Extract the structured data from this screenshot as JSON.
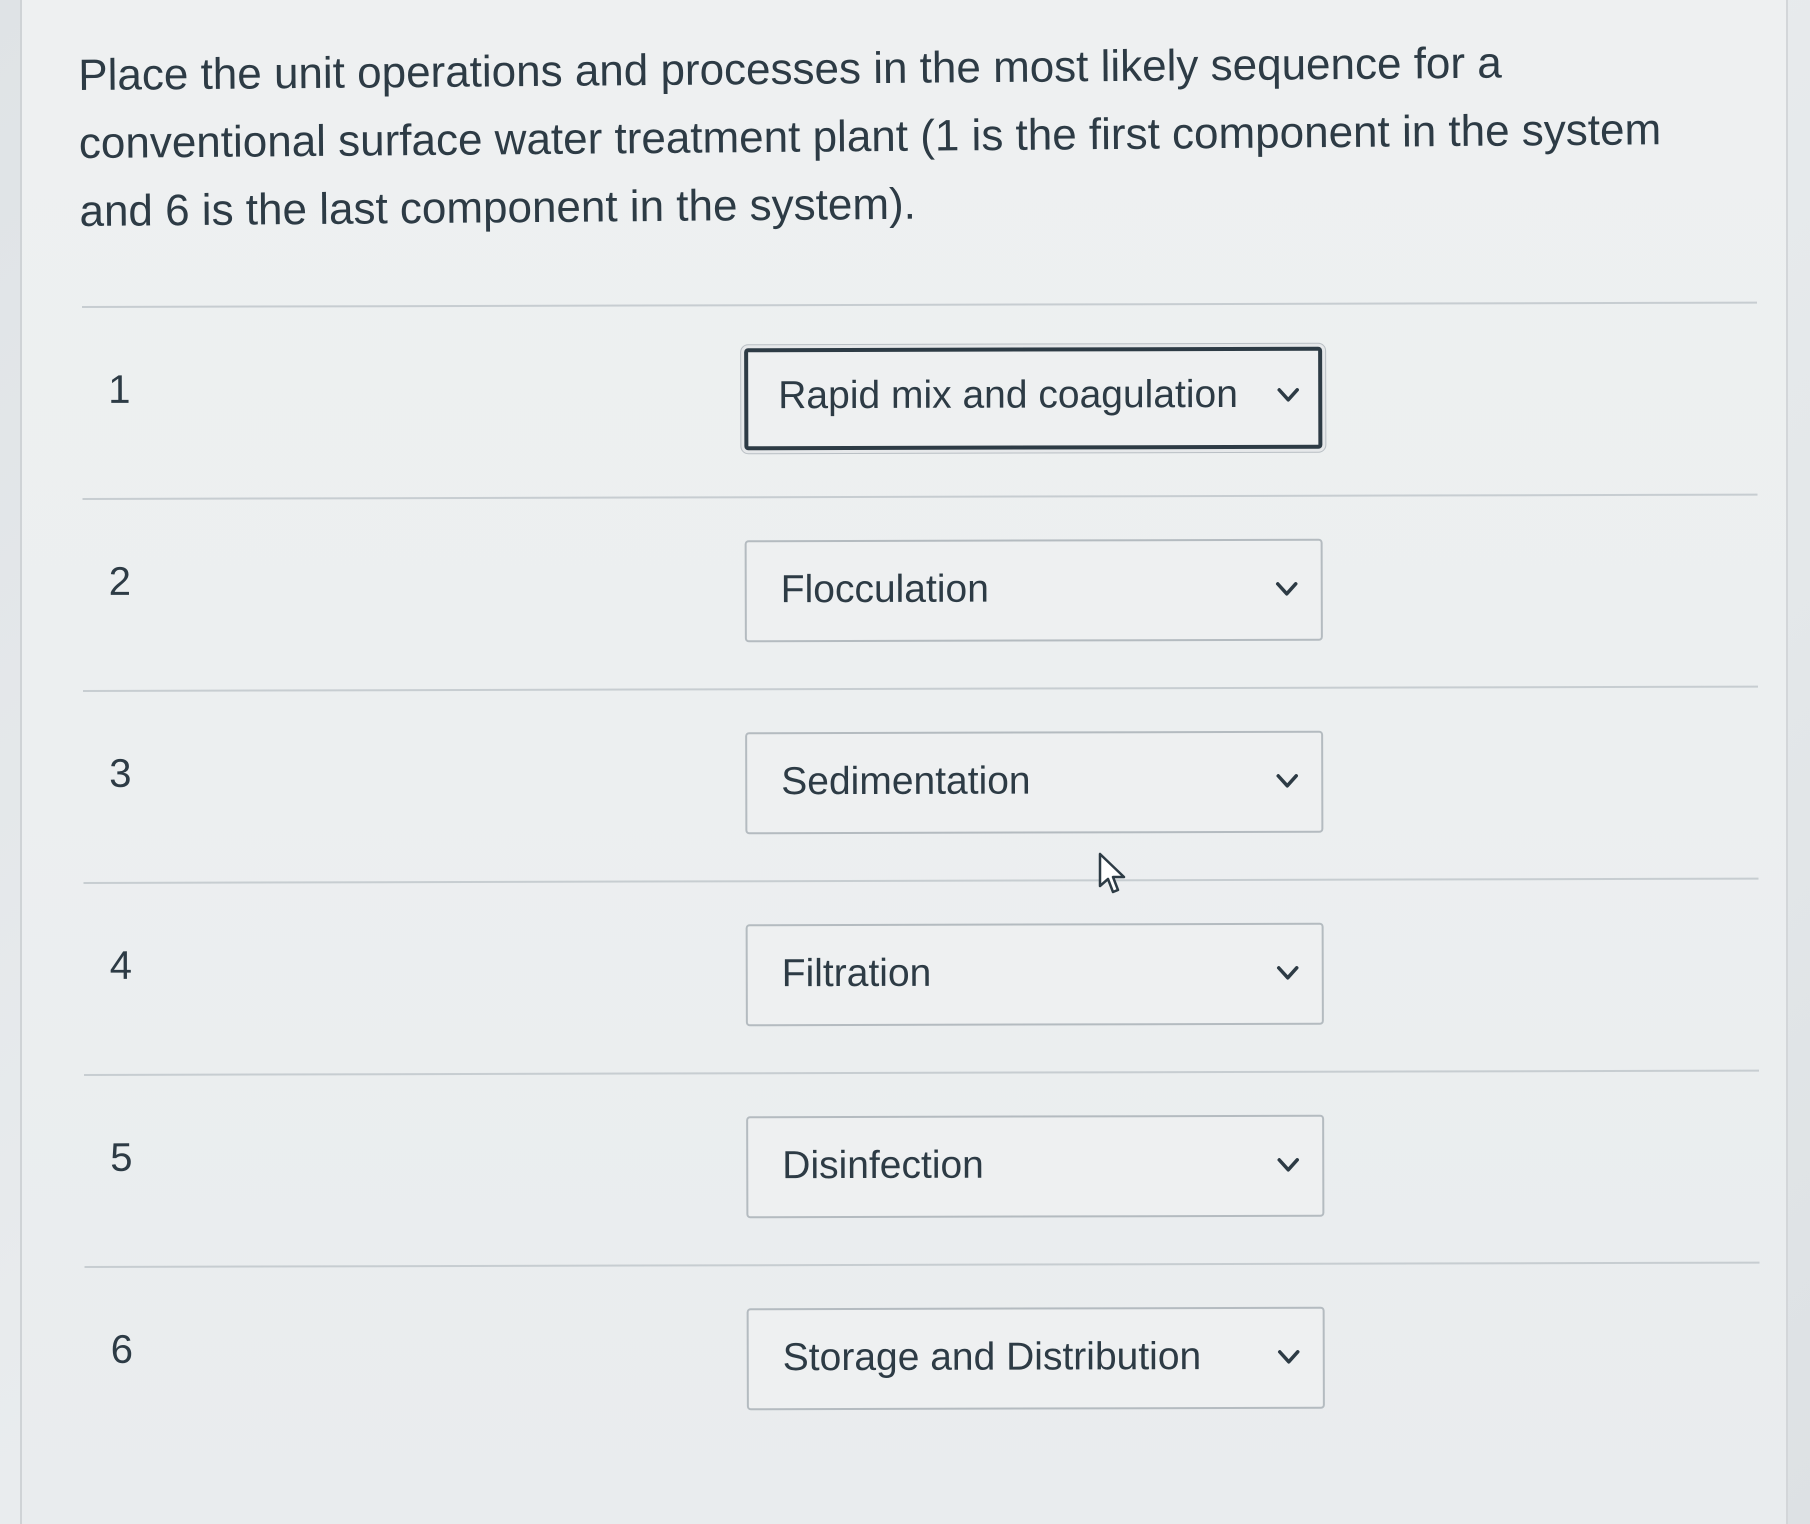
{
  "question": {
    "text": "Place the unit operations and processes in the most likely sequence for a conventional surface water treatment plant (1 is the first component in the system and 6 is the last component in the system)."
  },
  "rows": [
    {
      "number": "1",
      "selected": "Rapid mix and coagulation",
      "focused": true
    },
    {
      "number": "2",
      "selected": "Flocculation",
      "focused": false
    },
    {
      "number": "3",
      "selected": "Sedimentation",
      "focused": false
    },
    {
      "number": "4",
      "selected": "Filtration",
      "focused": false
    },
    {
      "number": "5",
      "selected": "Disinfection",
      "focused": false
    },
    {
      "number": "6",
      "selected": "Storage and Distribution",
      "focused": false
    }
  ],
  "icons": {
    "dropdown": "chevron-down-icon",
    "pointer": "mouse-pointer-icon"
  },
  "colors": {
    "text": "#2d3b45",
    "border": "#b4bbc0",
    "focus_border": "#2d3b45"
  }
}
